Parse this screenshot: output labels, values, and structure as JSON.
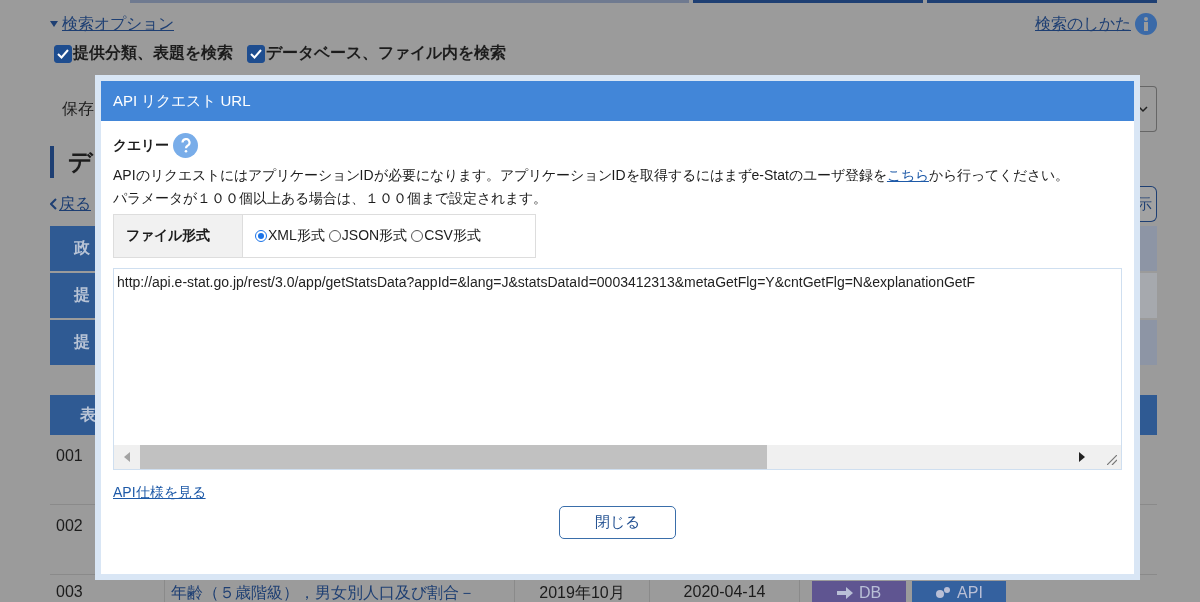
{
  "search_options": {
    "label": "検索オプション",
    "expanded": true
  },
  "search_checks": [
    {
      "label": "提供分類、表題を検索",
      "checked": true
    },
    {
      "label": "データベース、ファイル内を検索",
      "checked": true
    }
  ],
  "help_link": "検索のしかた",
  "save_label": "保存",
  "heading": "デ",
  "back_link": "戻る",
  "display_button": "示",
  "filter_table": {
    "rows": [
      {
        "header": "政"
      },
      {
        "header": "提"
      },
      {
        "header": "提"
      }
    ]
  },
  "stats_table": {
    "columns": [
      "表"
    ],
    "rows": [
      {
        "number": "001"
      },
      {
        "number": "002"
      },
      {
        "number": "003",
        "title": "年齢（５歳階級），男女別人口及び割合－",
        "survey_date": "2019年10月",
        "published": "2020-04-14",
        "db_button": "DB",
        "api_button": "API"
      }
    ]
  },
  "dialog": {
    "title": "API リクエスト URL",
    "section_label": "クエリー",
    "notice_before": "APIのリクエストにはアプリケーションIDが必要になります。アプリケーションIDを取得するにはまずe-Statのユーザ登録を",
    "notice_link": "こちら",
    "notice_after": "から行ってください。",
    "parameter_note": "パラメータが１００個以上ある場合は、１００個まで設定されます。",
    "format_label": "ファイル形式",
    "formats": [
      {
        "label": "XML形式",
        "selected": true
      },
      {
        "label": "JSON形式",
        "selected": false
      },
      {
        "label": "CSV形式",
        "selected": false
      }
    ],
    "url": "http://api.e-stat.go.jp/rest/3.0/app/getStatsData?appId=&lang=J&statsDataId=0003412313&metaGetFlg=Y&cntGetFlg=N&explanationGetF",
    "spec_link": "API仕様を見る",
    "close_button": "閉じる"
  }
}
